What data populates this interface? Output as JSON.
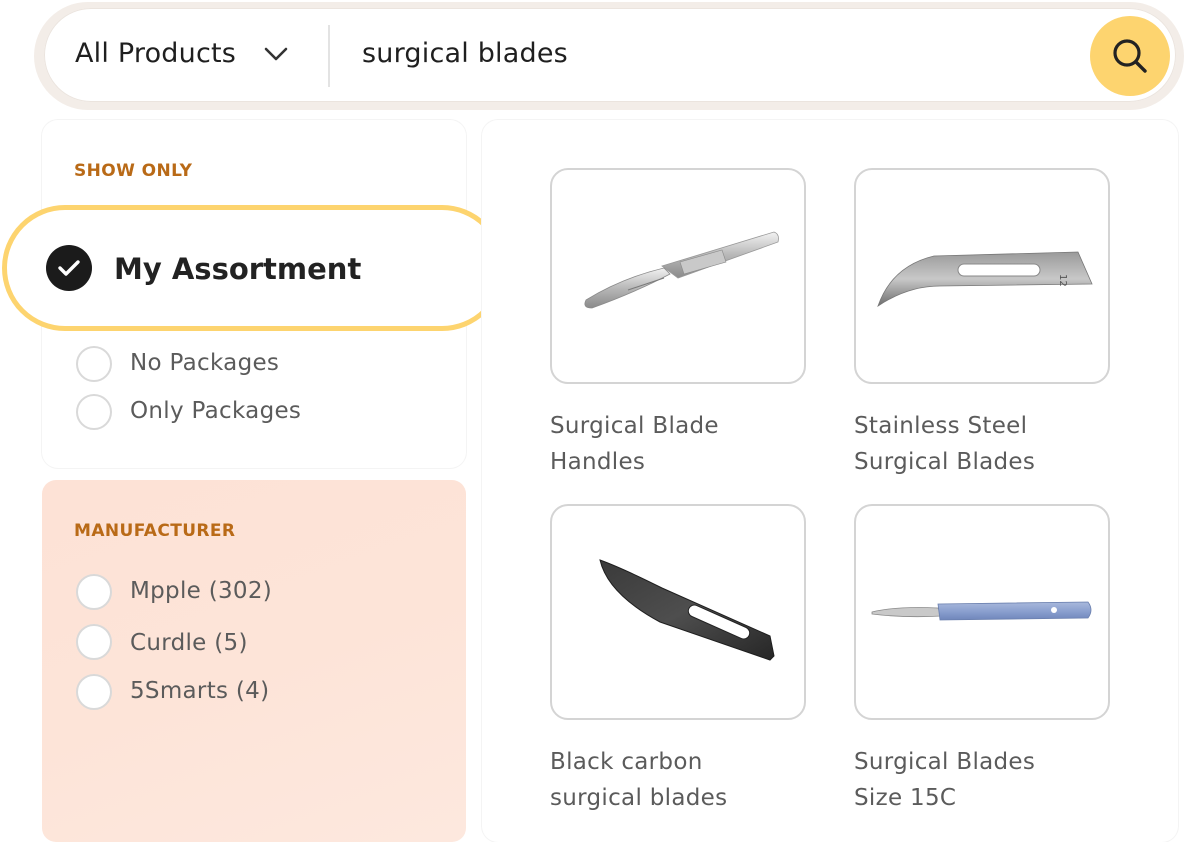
{
  "search": {
    "category": "All Products",
    "query": "surgical blades"
  },
  "filters": {
    "show_only": {
      "title": "SHOW ONLY",
      "selected": "My Assortment",
      "options": [
        "No Packages",
        "Only Packages"
      ]
    },
    "manufacturer": {
      "title": "MANUFACTURER",
      "options": [
        "Mpple (302)",
        "Curdle (5)",
        "5Smarts (4)"
      ]
    }
  },
  "products": [
    {
      "title_line1": "Surgical Blade",
      "title_line2": "Handles"
    },
    {
      "title_line1": "Stainless Steel",
      "title_line2": "Surgical Blades"
    },
    {
      "title_line1": "Black carbon",
      "title_line2": "surgical blades"
    },
    {
      "title_line1": "Surgical Blades",
      "title_line2": "Size 15C"
    }
  ],
  "icons": {
    "search": "search-icon",
    "chevron": "chevron-down-icon",
    "check": "check-icon"
  },
  "colors": {
    "accent": "#fdd46f",
    "section_title": "#b96a17",
    "manufacturer_bg": "#fde2d6"
  }
}
